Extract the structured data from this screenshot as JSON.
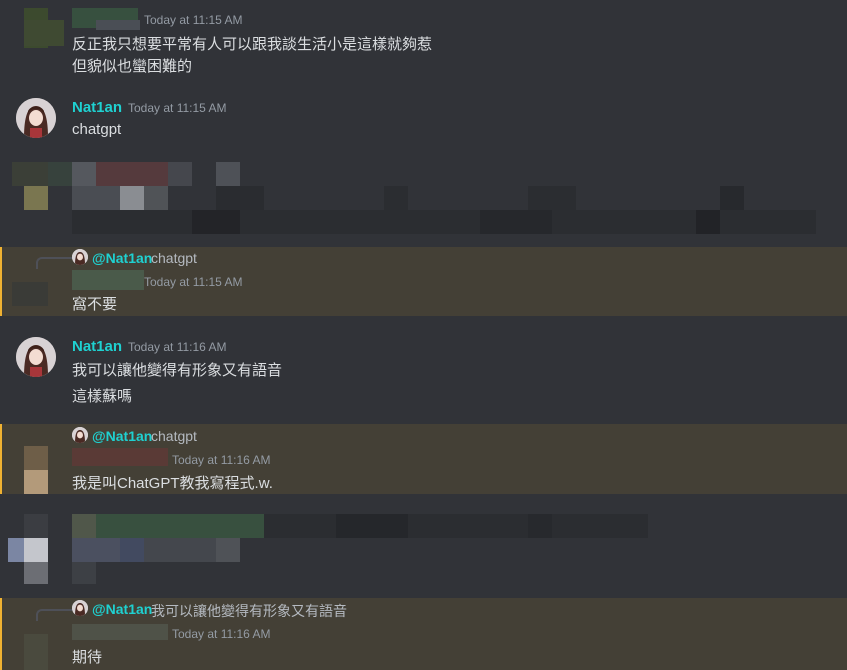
{
  "messages": [
    {
      "timestamp": "Today at 11:15 AM",
      "lines": [
        "反正我只想要平常有人可以跟我談生活小是這樣就夠惹",
        "但貌似也蠻困難的"
      ]
    },
    {
      "author": "Nat1an",
      "timestamp": "Today at 11:15 AM",
      "lines": [
        "chatgpt"
      ]
    },
    {
      "reply_to": "@Nat1an",
      "reply_text": "chatgpt",
      "timestamp": "Today at 11:15 AM",
      "lines": [
        "窩不要"
      ]
    },
    {
      "author": "Nat1an",
      "timestamp": "Today at 11:16 AM",
      "lines": [
        "我可以讓他變得有形象又有語音",
        "這樣蘇嗎"
      ]
    },
    {
      "reply_to": "@Nat1an",
      "reply_text": "chatgpt",
      "timestamp": "Today at 11:16 AM",
      "lines": [
        "我是叫ChatGPT教我寫程式.w."
      ]
    },
    {
      "reply_to": "@Nat1an",
      "reply_text": "我可以讓他變得有形象又有語音",
      "timestamp": "Today at 11:16 AM",
      "lines": [
        "期待"
      ]
    }
  ],
  "colors": {
    "background": "#313338",
    "mention_highlight": "#444036",
    "mention_bar": "#f0b232",
    "author_name": "#1fd1d1"
  },
  "icons": {
    "avatar": "anime-avatar-icon"
  }
}
